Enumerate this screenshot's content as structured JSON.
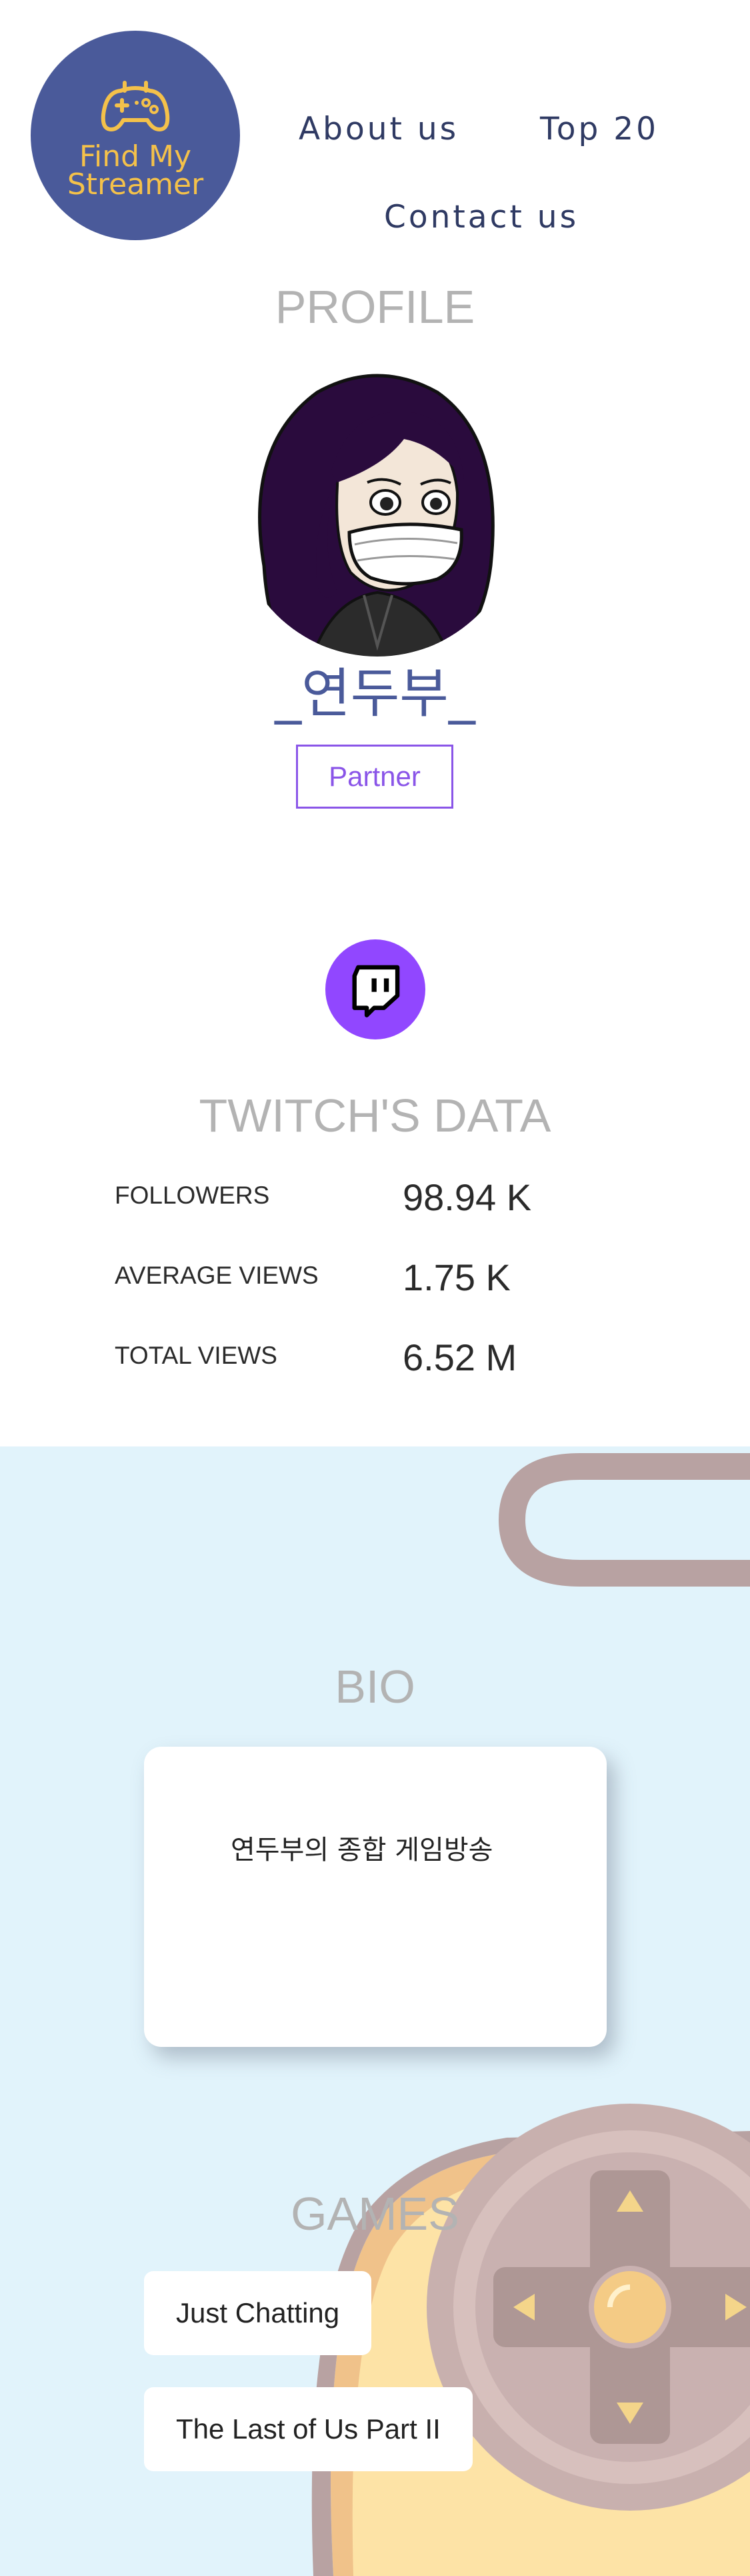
{
  "header": {
    "logo": {
      "line1": "Find My",
      "line2": "Streamer",
      "icon": "gamepad-icon"
    },
    "nav": [
      {
        "label": "About us"
      },
      {
        "label": "Top 20"
      },
      {
        "label": "Contact us"
      }
    ]
  },
  "profile": {
    "title": "PROFILE",
    "name": "_연두부_",
    "badge": "Partner"
  },
  "twitch": {
    "icon": "twitch-icon",
    "title": "TWITCH'S DATA",
    "stats": [
      {
        "label": "FOLLOWERS",
        "value": "98.94 K"
      },
      {
        "label": "AVERAGE VIEWS",
        "value": "1.75 K"
      },
      {
        "label": "TOTAL VIEWS",
        "value": "6.52 M"
      }
    ]
  },
  "bio": {
    "title": "BIO",
    "text": "연두부의 종합 게임방송"
  },
  "games": {
    "title": "GAMES",
    "items": [
      {
        "label": "Just Chatting"
      },
      {
        "label": "The Last of Us Part II"
      }
    ]
  },
  "colors": {
    "brand": "#4a5a9a",
    "logo_text": "#f4c14a",
    "accent": "#8a55e8",
    "twitch": "#9147ff",
    "panel_bg": "#e1f3fb"
  }
}
